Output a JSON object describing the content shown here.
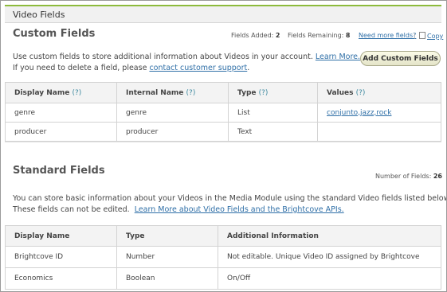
{
  "panel": {
    "title": "Video Fields"
  },
  "custom": {
    "heading": "Custom Fields",
    "fields_added_label": "Fields Added:",
    "fields_added": "2",
    "fields_remaining_label": "Fields Remaining:",
    "fields_remaining": "8",
    "need_more_link": "Need more fields?",
    "copy_link": "Copy",
    "desc_line1": "Use custom fields to store additional information about Videos in your account.",
    "learn_more_link": "Learn More.",
    "desc_line2_prefix": "If you need to delete a field, please",
    "contact_link": "contact customer support",
    "desc_line2_suffix": ".",
    "add_button": "Add Custom Fields",
    "columns": [
      "Display Name",
      "Internal Name",
      "Type",
      "Values"
    ],
    "help_mark": "(?)",
    "rows": [
      {
        "display": "genre",
        "internal": "genre",
        "type": "List",
        "values": "conjunto,jazz,rock"
      },
      {
        "display": "producer",
        "internal": "producer",
        "type": "Text",
        "values": ""
      }
    ]
  },
  "standard": {
    "heading": "Standard Fields",
    "count_label": "Number of Fields:",
    "count": "26",
    "desc_line1": "You can store basic information about your Videos in the Media Module using the standard Video fields listed below.",
    "desc_line2": "These fields can not be edited.",
    "learn_link": "Learn More about Video Fields and the Brightcove APIs.",
    "columns": [
      "Display Name",
      "Type",
      "Additional Information"
    ],
    "rows": [
      {
        "display": "Brightcove ID",
        "type": "Number",
        "info": "Not editable. Unique Video ID assigned by Brightcove"
      },
      {
        "display": "Economics",
        "type": "Boolean",
        "info": "On/Off"
      }
    ]
  }
}
